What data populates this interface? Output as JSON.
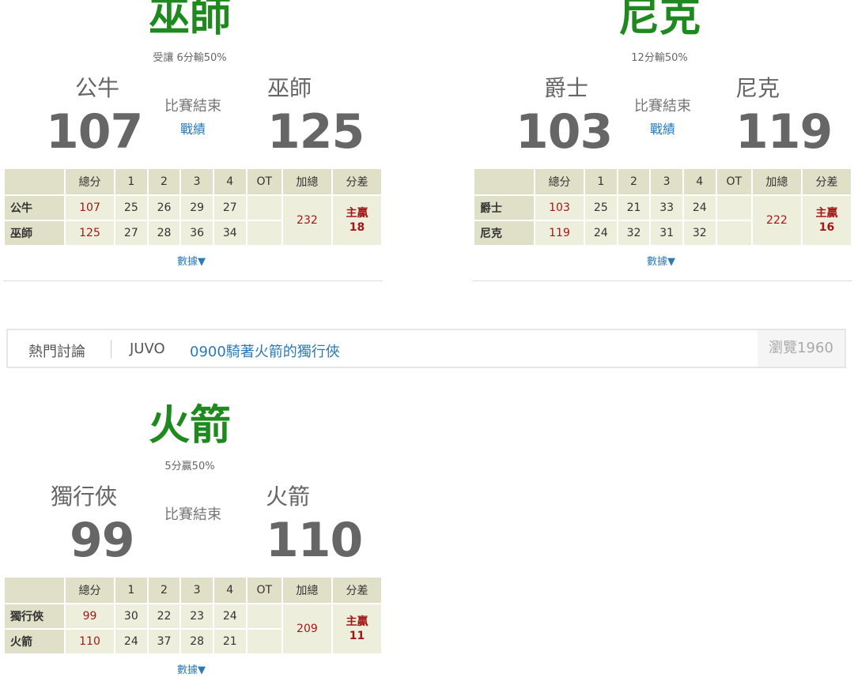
{
  "games": [
    {
      "winner": "巫師",
      "spread": "受讓 6分輸50%",
      "away": {
        "name": "公牛",
        "score": "107"
      },
      "home": {
        "name": "巫師",
        "score": "125"
      },
      "status": "比賽結束",
      "record_link": "戰績",
      "headers": [
        "",
        "總分",
        "1",
        "2",
        "3",
        "4",
        "OT",
        "加總",
        "分差"
      ],
      "rows": [
        {
          "team": "公牛",
          "total": "107",
          "q": [
            "25",
            "26",
            "29",
            "27"
          ],
          "ot": ""
        },
        {
          "team": "巫師",
          "total": "125",
          "q": [
            "27",
            "28",
            "36",
            "34"
          ],
          "ot": ""
        }
      ],
      "aggregate": "232",
      "diff_label": "主贏",
      "diff_value": "18",
      "more": "數據▼"
    },
    {
      "winner": "尼克",
      "spread": "12分輸50%",
      "away": {
        "name": "爵士",
        "score": "103"
      },
      "home": {
        "name": "尼克",
        "score": "119"
      },
      "status": "比賽結束",
      "record_link": "戰績",
      "headers": [
        "",
        "總分",
        "1",
        "2",
        "3",
        "4",
        "OT",
        "加總",
        "分差"
      ],
      "rows": [
        {
          "team": "爵士",
          "total": "103",
          "q": [
            "25",
            "21",
            "33",
            "24"
          ],
          "ot": ""
        },
        {
          "team": "尼克",
          "total": "119",
          "q": [
            "24",
            "32",
            "31",
            "32"
          ],
          "ot": ""
        }
      ],
      "aggregate": "222",
      "diff_label": "主贏",
      "diff_value": "16",
      "more": "數據▼"
    },
    {
      "winner": "火箭",
      "spread": "5分贏50%",
      "away": {
        "name": "獨行俠",
        "score": "99"
      },
      "home": {
        "name": "火箭",
        "score": "110"
      },
      "status": "比賽結束",
      "record_link": "",
      "headers": [
        "",
        "總分",
        "1",
        "2",
        "3",
        "4",
        "OT",
        "加總",
        "分差"
      ],
      "rows": [
        {
          "team": "獨行俠",
          "total": "99",
          "q": [
            "30",
            "22",
            "23",
            "24"
          ],
          "ot": ""
        },
        {
          "team": "火箭",
          "total": "110",
          "q": [
            "24",
            "37",
            "28",
            "21"
          ],
          "ot": ""
        }
      ],
      "aggregate": "209",
      "diff_label": "主贏",
      "diff_value": "11",
      "more": "數據▼"
    }
  ],
  "hot": {
    "label": "熱門討論",
    "user": "JUVO",
    "title": "0900騎著火箭的獨行俠",
    "views": "瀏覽1960"
  },
  "colors": {
    "winner": "#1e8a1e",
    "link": "#2a7ab8",
    "accent_red": "#a01818",
    "table_bg": "#eeeedd",
    "table_head": "#e0e0c8"
  }
}
